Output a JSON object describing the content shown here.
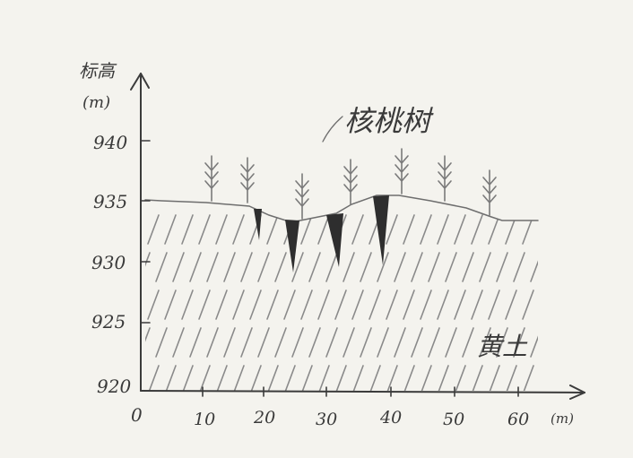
{
  "y_axis": {
    "label_line1": "标高",
    "label_line2": "(m)",
    "ticks": [
      "940",
      "935",
      "930",
      "925",
      "920"
    ]
  },
  "x_axis": {
    "ticks": [
      "0",
      "10",
      "20",
      "30",
      "40",
      "50",
      "60"
    ],
    "unit": "(m)"
  },
  "labels": {
    "trees": "核桃树",
    "soil": "黄土"
  }
}
